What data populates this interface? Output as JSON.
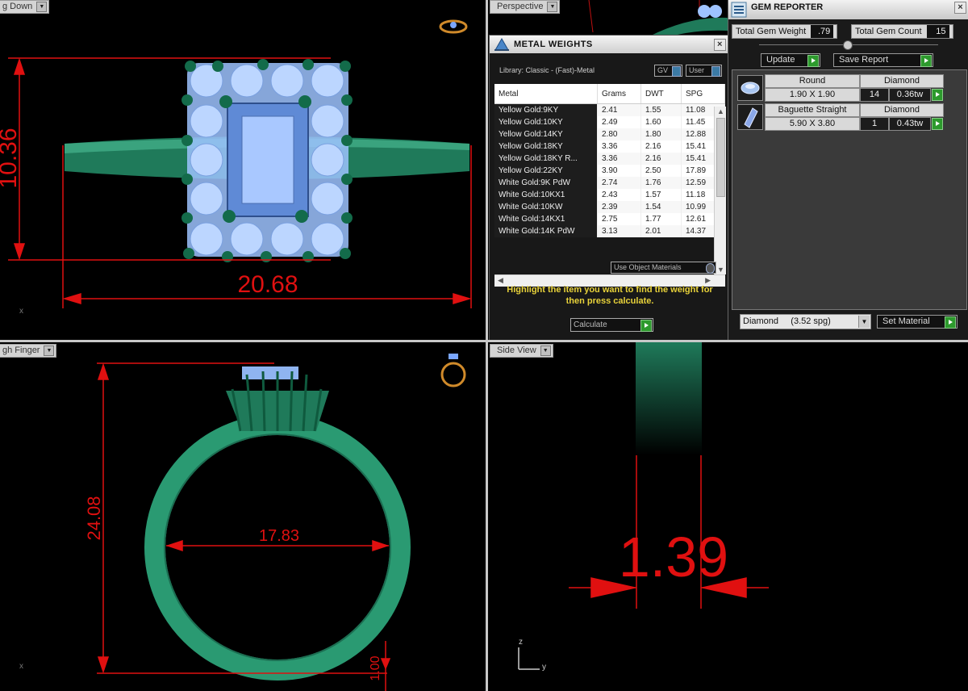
{
  "viewports": {
    "top_left": {
      "label": "g Down",
      "dim_width": "20.68",
      "dim_height": "10.36"
    },
    "top_right": {
      "label": "Perspective"
    },
    "bottom_left": {
      "label": "gh Finger",
      "dim_height": "24.08",
      "dim_diameter": "17.83",
      "dim_thickness": "1.00"
    },
    "bottom_right": {
      "label": "Side View",
      "dim_thickness": "1.39",
      "axis_z": "z",
      "axis_y": "y"
    },
    "axis_x": "x"
  },
  "metal_weights": {
    "title": "METAL WEIGHTS",
    "library": "Library: Classic - (Fast)-Metal",
    "gv_label": "GV",
    "user_label": "User",
    "columns": [
      "Metal",
      "Grams",
      "DWT",
      "SPG"
    ],
    "rows": [
      [
        "Yellow Gold:9KY",
        "2.41",
        "1.55",
        "11.08"
      ],
      [
        "Yellow Gold:10KY",
        "2.49",
        "1.60",
        "11.45"
      ],
      [
        "Yellow Gold:14KY",
        "2.80",
        "1.80",
        "12.88"
      ],
      [
        "Yellow Gold:18KY",
        "3.36",
        "2.16",
        "15.41"
      ],
      [
        "Yellow Gold:18KY R...",
        "3.36",
        "2.16",
        "15.41"
      ],
      [
        "Yellow Gold:22KY",
        "3.90",
        "2.50",
        "17.89"
      ],
      [
        "White Gold:9K PdW",
        "2.74",
        "1.76",
        "12.59"
      ],
      [
        "White Gold:10KX1",
        "2.43",
        "1.57",
        "11.18"
      ],
      [
        "White Gold:10KW",
        "2.39",
        "1.54",
        "10.99"
      ],
      [
        "White Gold:14KX1",
        "2.75",
        "1.77",
        "12.61"
      ],
      [
        "White Gold:14K PdW",
        "3.13",
        "2.01",
        "14.37"
      ]
    ],
    "use_object_materials": "Use Object Materials",
    "message": "Highlight the item you want to find the weight for then press calculate.",
    "calculate_label": "Calculate"
  },
  "gem_reporter": {
    "title": "GEM REPORTER",
    "total_weight_label": "Total Gem Weight",
    "total_weight_value": ".79",
    "total_count_label": "Total Gem Count",
    "total_count_value": "15",
    "update_label": "Update",
    "save_report_label": "Save Report",
    "gems": [
      {
        "icon": "round-gem-icon",
        "cut": "Round",
        "material": "Diamond",
        "size": "1.90 X 1.90",
        "count": "14",
        "weight": "0.36tw"
      },
      {
        "icon": "baguette-gem-icon",
        "cut": "Baguette Straight",
        "material": "Diamond",
        "size": "5.90 X 3.80",
        "count": "1",
        "weight": "0.43tw"
      }
    ],
    "material_select": "Diamond     (3.52 spg)",
    "set_material_label": "Set Material"
  }
}
